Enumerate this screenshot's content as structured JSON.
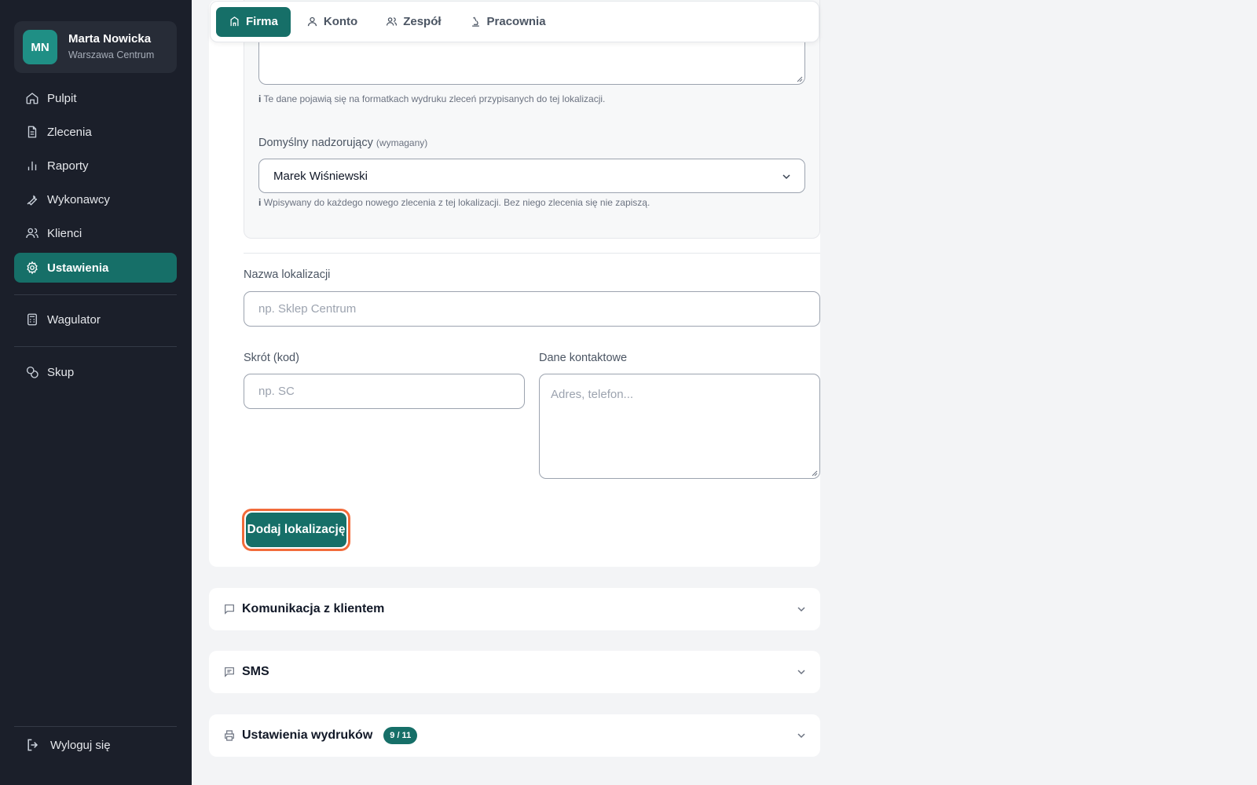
{
  "user": {
    "initials": "MN",
    "name": "Marta Nowicka",
    "location": "Warszawa Centrum"
  },
  "nav": {
    "items": [
      {
        "label": "Pulpit",
        "icon": "home-icon"
      },
      {
        "label": "Zlecenia",
        "icon": "document-icon"
      },
      {
        "label": "Raporty",
        "icon": "bar-chart-icon"
      },
      {
        "label": "Wykonawcy",
        "icon": "wrench-icon"
      },
      {
        "label": "Klienci",
        "icon": "users-icon"
      },
      {
        "label": "Ustawienia",
        "icon": "gear-icon",
        "active": true
      },
      {
        "label": "Wagulator",
        "icon": "calculator-icon"
      },
      {
        "label": "Skup",
        "icon": "coins-icon"
      }
    ],
    "logout": "Wyloguj się"
  },
  "tabs": [
    {
      "label": "Firma",
      "icon": "building-icon",
      "active": true
    },
    {
      "label": "Konto",
      "icon": "user-icon"
    },
    {
      "label": "Zespół",
      "icon": "users-icon"
    },
    {
      "label": "Pracownia",
      "icon": "microscope-icon"
    }
  ],
  "location_form": {
    "print_hint_icon": "i",
    "print_hint": "Te dane pojawią się na formatkach wydruku zleceń przypisanych do tej lokalizacji.",
    "supervisor_label": "Domyślny nadzorujący",
    "supervisor_required": "(wymagany)",
    "supervisor_value": "Marek Wiśniewski",
    "supervisor_hint_icon": "i",
    "supervisor_hint": "Wpisywany do każdego nowego zlecenia z tej lokalizacji. Bez niego zlecenia się nie zapiszą.",
    "name_label": "Nazwa lokalizacji",
    "name_placeholder": "np. Sklep Centrum",
    "code_label": "Skrót (kod)",
    "code_placeholder": "np. SC",
    "contact_label": "Dane kontaktowe",
    "contact_placeholder": "Adres, telefon...",
    "add_button": "Dodaj lokalizację"
  },
  "accordions": [
    {
      "title": "Komunikacja z klientem",
      "icon": "chat-icon"
    },
    {
      "title": "SMS",
      "icon": "message-icon"
    },
    {
      "title": "Ustawienia wydruków",
      "icon": "printer-icon",
      "badge": "9 / 11"
    }
  ],
  "colors": {
    "accent": "#166f68",
    "sidebar": "#1b1f2a",
    "focus_ring": "#f26b3a"
  }
}
